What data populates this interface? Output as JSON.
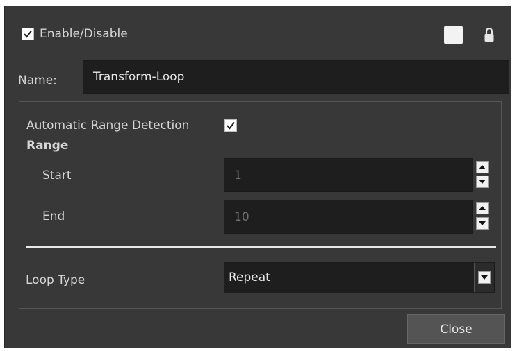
{
  "enable": {
    "label": "Enable/Disable",
    "checked": true
  },
  "header_icons": {
    "color_swatch": "white-color-swatch-icon",
    "lock": "lock-icon"
  },
  "name": {
    "label": "Name:",
    "value": "Transform-Loop"
  },
  "auto_range": {
    "label": "Automatic Range Detection",
    "checked": true
  },
  "range": {
    "heading": "Range",
    "start_label": "Start",
    "start_value": "1",
    "end_label": "End",
    "end_value": "10"
  },
  "loop_type": {
    "label": "Loop Type",
    "value": "Repeat"
  },
  "close_label": "Close",
  "colors": {
    "dialog_bg": "#383838",
    "field_bg": "#1e1e1e",
    "text": "#d6d6d6",
    "disabled_text": "#707070",
    "button_bg": "#545454"
  }
}
